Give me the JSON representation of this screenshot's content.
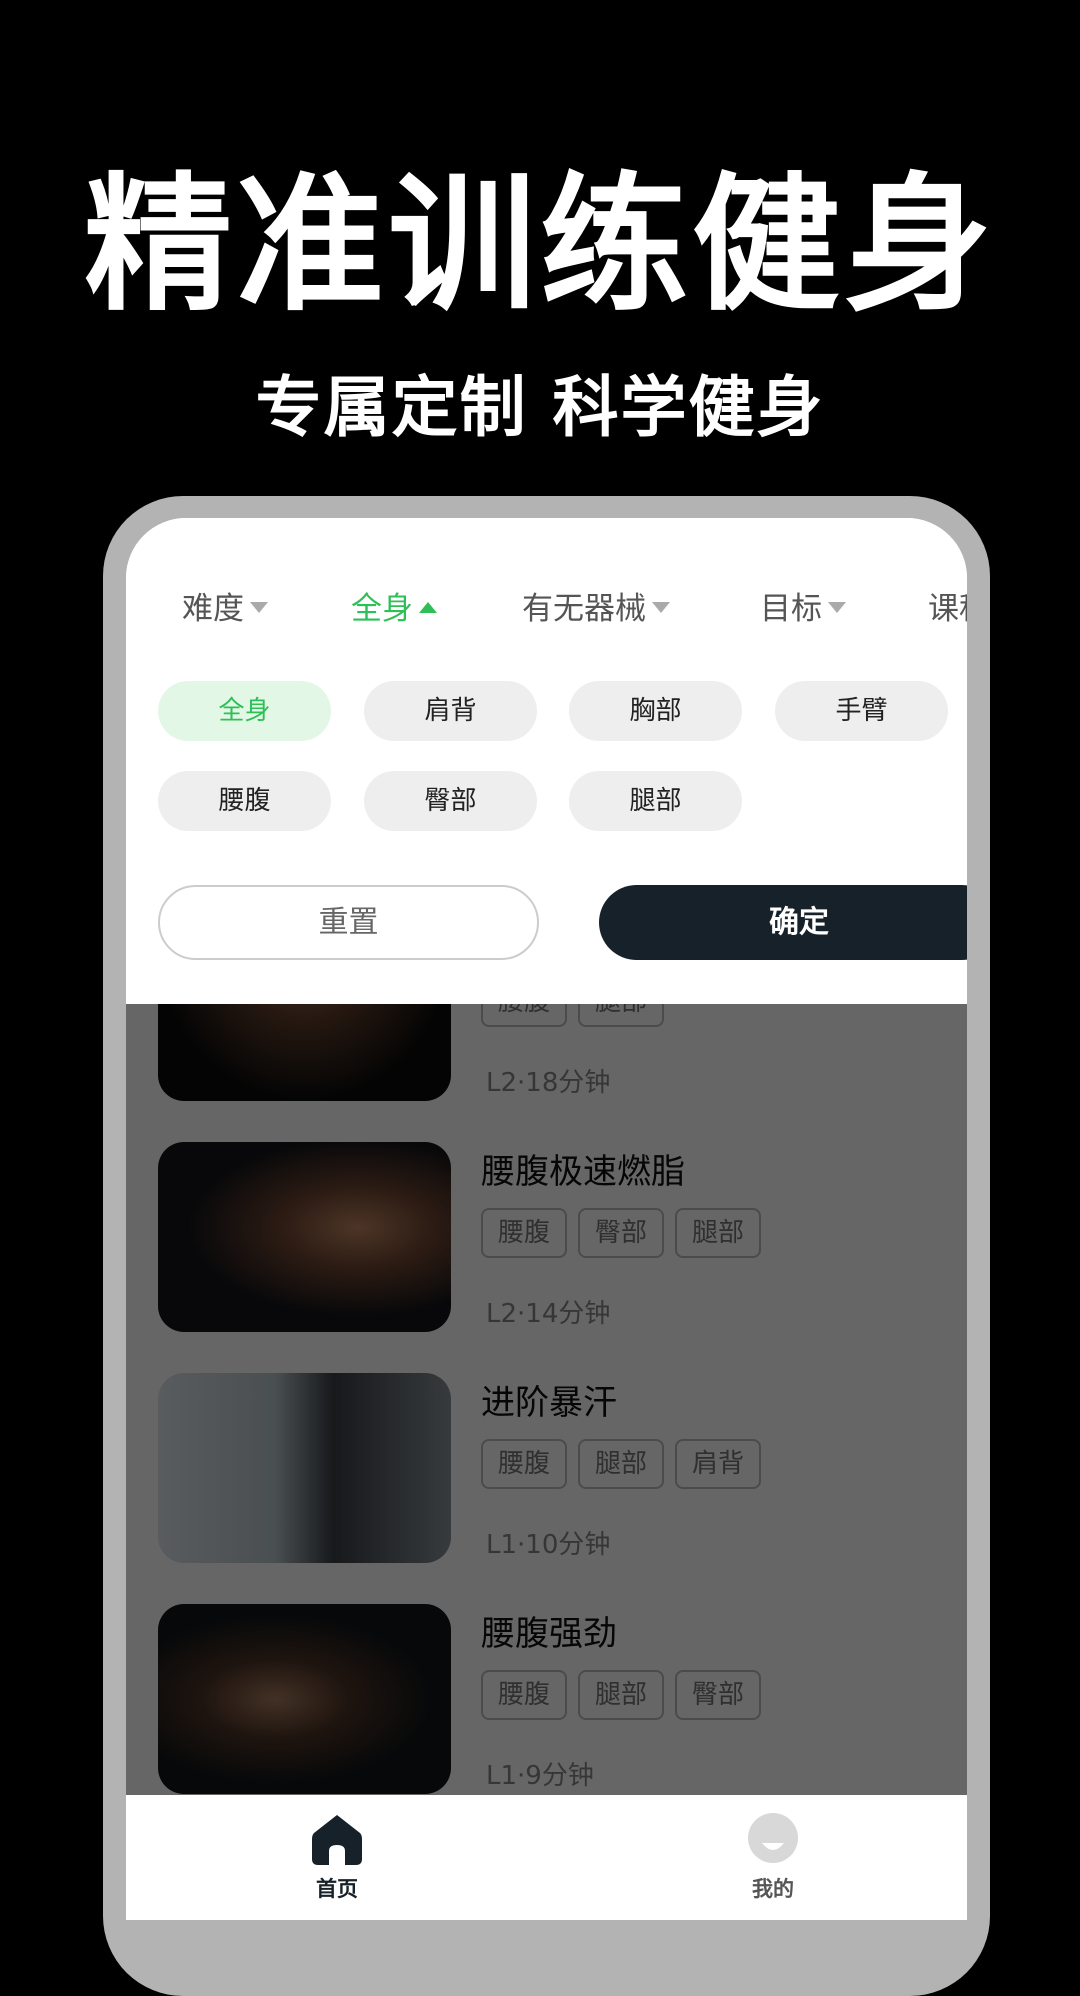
{
  "promo": {
    "headline": "精准训练健身",
    "subline": "专属定制 科学健身"
  },
  "filters": {
    "tabs": [
      {
        "label": "难度",
        "state": "collapsed"
      },
      {
        "label": "全身",
        "state": "expanded"
      },
      {
        "label": "有无器械",
        "state": "collapsed"
      },
      {
        "label": "目标",
        "state": "collapsed"
      },
      {
        "label": "课程"
      }
    ],
    "chips": [
      {
        "label": "全身",
        "selected": true
      },
      {
        "label": "肩背"
      },
      {
        "label": "胸部"
      },
      {
        "label": "手臂"
      },
      {
        "label": "腰腹"
      },
      {
        "label": "臀部"
      },
      {
        "label": "腿部"
      }
    ],
    "reset_label": "重置",
    "confirm_label": "确定"
  },
  "courses": [
    {
      "title": "",
      "tags": [
        "腰腹",
        "腿部"
      ],
      "meta": "L2·18分钟"
    },
    {
      "title": "腰腹极速燃脂",
      "tags": [
        "腰腹",
        "臀部",
        "腿部"
      ],
      "meta": "L2·14分钟"
    },
    {
      "title": "进阶暴汗",
      "tags": [
        "腰腹",
        "腿部",
        "肩背"
      ],
      "meta": "L1·10分钟"
    },
    {
      "title": "腰腹强劲",
      "tags": [
        "腰腹",
        "腿部",
        "臀部"
      ],
      "meta": "L1·9分钟"
    }
  ],
  "nav": [
    {
      "label": "首页",
      "icon": "home-icon",
      "active": true
    },
    {
      "label": "我的",
      "icon": "profile-icon"
    }
  ],
  "colors": {
    "accent": "#2fbf57",
    "dark": "#16212a"
  }
}
